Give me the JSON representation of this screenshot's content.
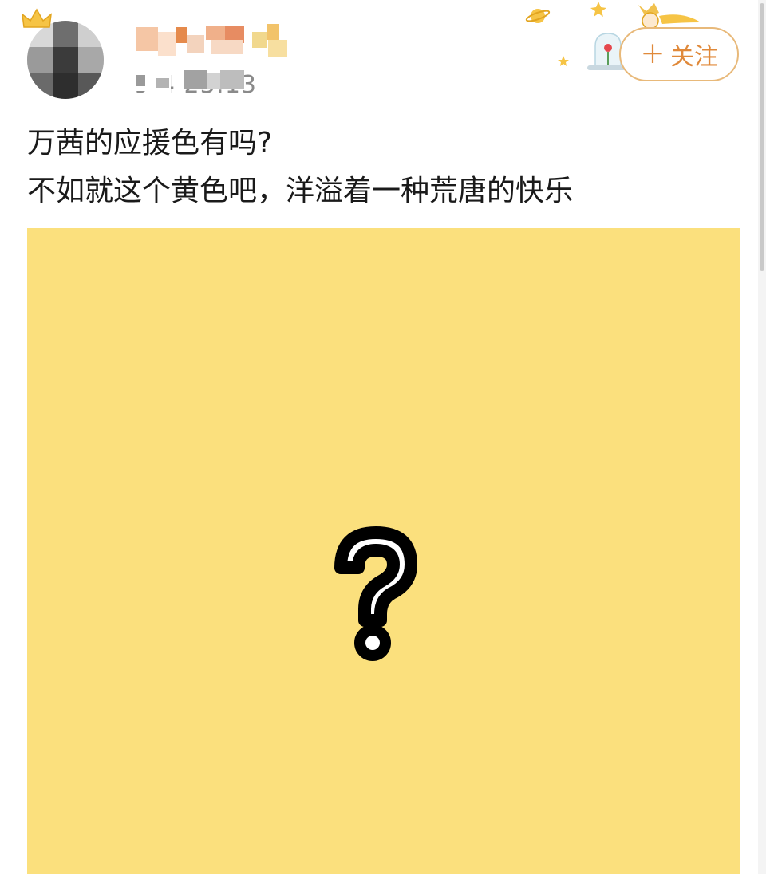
{
  "post": {
    "time": "9-4 23:13",
    "text_line_1": "万茜的应援色有吗?",
    "text_line_2": "不如就这个黄色吧，洋溢着一种荒唐的快乐"
  },
  "follow_button": {
    "label": "关注",
    "icon": "plus-icon"
  },
  "image": {
    "background_color": "#fbe07d",
    "icon": "question-mark-icon"
  },
  "colors": {
    "accent": "#e0893a",
    "button_border": "#e8b97a",
    "text": "#1a1a1a",
    "muted": "#8a8a8a"
  }
}
